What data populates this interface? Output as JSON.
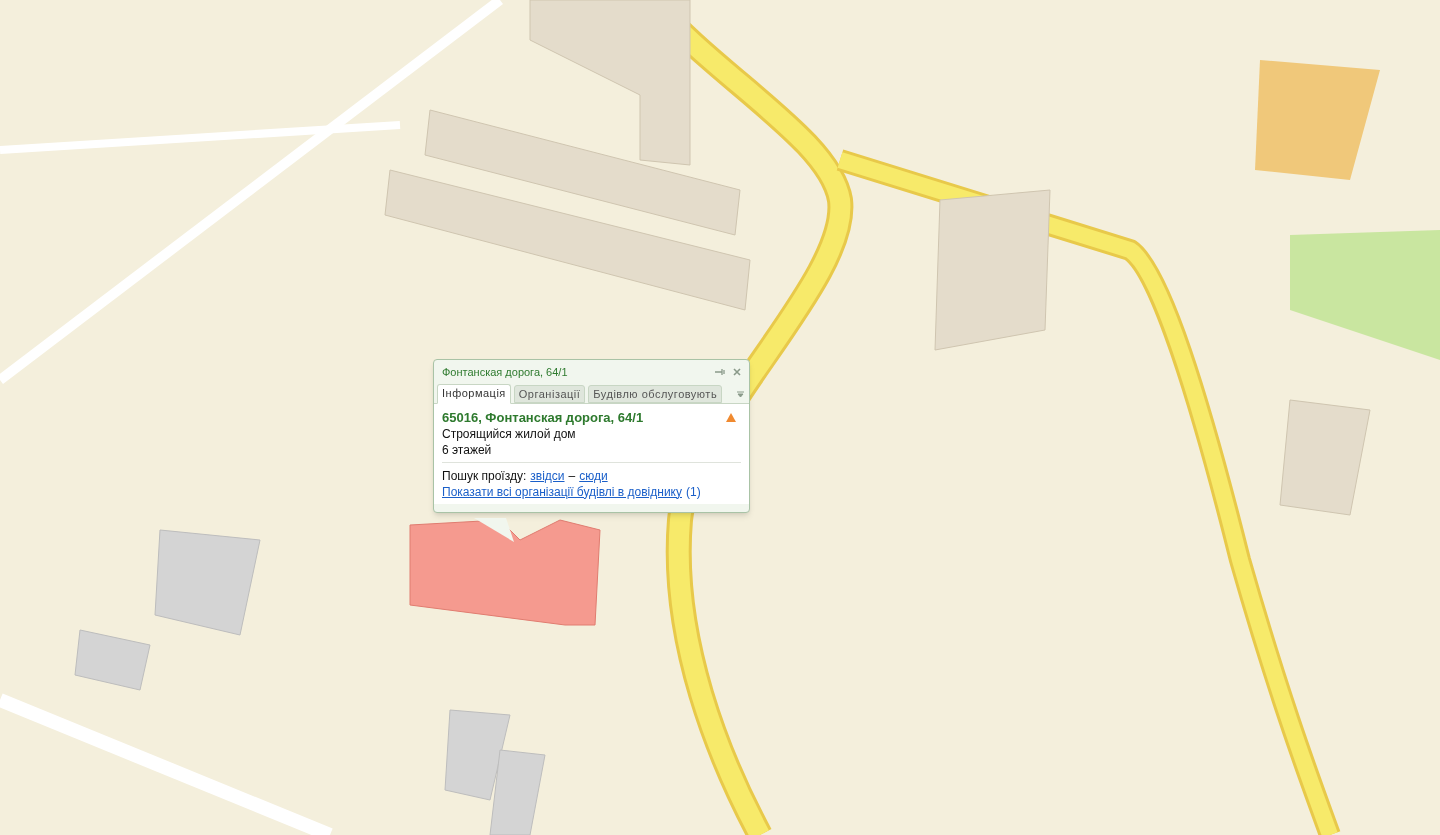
{
  "popup": {
    "title": "Фонтанская дорога, 64/1",
    "tabs": [
      {
        "label": "Інформація",
        "selected": true
      },
      {
        "label": "Організації",
        "selected": false
      },
      {
        "label": "Будівлю обслуговують",
        "selected": false
      }
    ],
    "address": "65016, Фонтанская дорога, 64/1",
    "description": "Строящийся жилой дом",
    "floors": "6 этажей",
    "route_label": "Пошук проїзду:",
    "route_from": "звідси",
    "route_separator": "–",
    "route_to": "сюди",
    "directory_link": "Показати всі організації будівлі в довіднику",
    "directory_count": "(1)"
  }
}
